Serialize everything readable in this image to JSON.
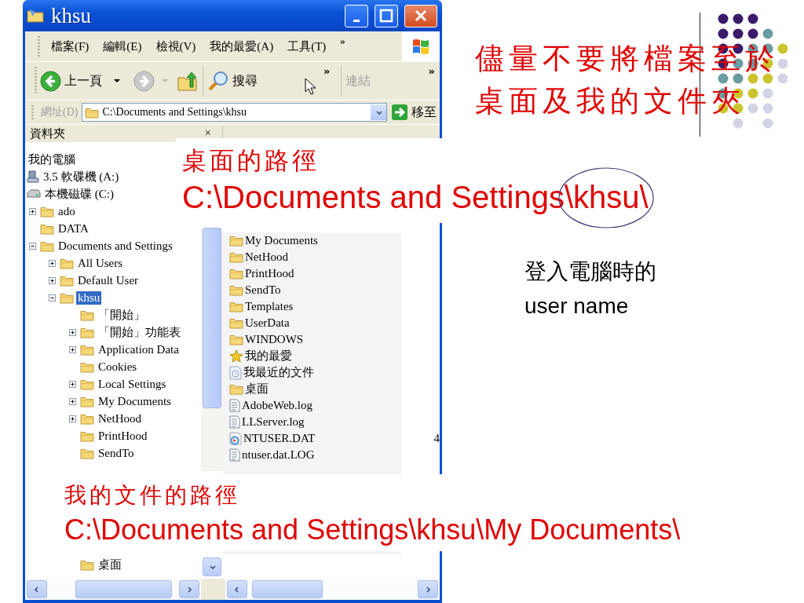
{
  "slide": {
    "title_lines": [
      "儘量不要將檔案至於",
      "桌面及我的文件夾"
    ]
  },
  "window": {
    "title": "khsu",
    "menu": [
      "檔案(F)",
      "編輯(E)",
      "檢視(V)",
      "我的最愛(A)",
      "工具(T)"
    ],
    "menu_overflow": "»",
    "toolbar": {
      "back": "上一頁",
      "search": "搜尋",
      "overflow": "»",
      "links": "連結",
      "links_overflow": "»"
    },
    "address": {
      "label": "網址(D)",
      "value": "C:\\Documents and Settings\\khsu",
      "go": "移至"
    },
    "folders_pane": {
      "title": "資料夾",
      "close": "×",
      "tree": [
        {
          "label": "我的電腦",
          "expandable": false,
          "selected": false,
          "children": [
            {
              "label": "3.5 軟碟機 (A:)",
              "kind": "floppy",
              "expandable": false,
              "selected": false
            },
            {
              "label": "本機磁碟 (C:)",
              "kind": "disk",
              "expandable": false,
              "selected": false,
              "children": [
                {
                  "label": "ado",
                  "kind": "folder",
                  "expandable": true,
                  "expanded": false,
                  "selected": false
                },
                {
                  "label": "DATA",
                  "kind": "folder",
                  "expandable": false,
                  "selected": false
                },
                {
                  "label": "Documents and Settings",
                  "kind": "folder",
                  "expandable": true,
                  "expanded": true,
                  "selected": false,
                  "children": [
                    {
                      "label": "All Users",
                      "kind": "folder",
                      "expandable": true,
                      "expanded": false,
                      "selected": false
                    },
                    {
                      "label": "Default User",
                      "kind": "folder",
                      "expandable": true,
                      "expanded": false,
                      "selected": false
                    },
                    {
                      "label": "khsu",
                      "kind": "folder",
                      "expandable": true,
                      "expanded": true,
                      "selected": true,
                      "children": [
                        {
                          "label": "「開始」",
                          "kind": "folder",
                          "expandable": false,
                          "selected": false
                        },
                        {
                          "label": "「開始」功能表",
                          "kind": "folder",
                          "expandable": true,
                          "expanded": false,
                          "selected": false
                        },
                        {
                          "label": "Application Data",
                          "kind": "folder",
                          "expandable": true,
                          "expanded": false,
                          "selected": false
                        },
                        {
                          "label": "Cookies",
                          "kind": "folder",
                          "expandable": false,
                          "selected": false
                        },
                        {
                          "label": "Local Settings",
                          "kind": "folder",
                          "expandable": true,
                          "expanded": false,
                          "selected": false
                        },
                        {
                          "label": "My Documents",
                          "kind": "folder",
                          "expandable": true,
                          "expanded": false,
                          "selected": false
                        },
                        {
                          "label": "NetHood",
                          "kind": "folder",
                          "expandable": true,
                          "expanded": false,
                          "selected": false
                        },
                        {
                          "label": "PrintHood",
                          "kind": "folder",
                          "expandable": false,
                          "selected": false
                        },
                        {
                          "label": "SendTo",
                          "kind": "folder",
                          "expandable": false,
                          "selected": false
                        }
                      ]
                    }
                  ]
                }
              ]
            }
          ]
        }
      ],
      "tree_tail": [
        {
          "label": "桌面",
          "kind": "folder",
          "expandable": false,
          "selected": false
        }
      ]
    },
    "file_list": [
      {
        "name": "My Documents",
        "kind": "folder"
      },
      {
        "name": "NetHood",
        "kind": "folder"
      },
      {
        "name": "PrintHood",
        "kind": "folder"
      },
      {
        "name": "SendTo",
        "kind": "folder"
      },
      {
        "name": "Templates",
        "kind": "folder"
      },
      {
        "name": "UserData",
        "kind": "folder"
      },
      {
        "name": "WINDOWS",
        "kind": "folder"
      },
      {
        "name": "我的最愛",
        "kind": "favorites"
      },
      {
        "name": "我最近的文件",
        "kind": "recent"
      },
      {
        "name": "桌面",
        "kind": "folder"
      },
      {
        "name": "AdobeWeb.log",
        "kind": "log"
      },
      {
        "name": "LLServer.log",
        "kind": "log"
      },
      {
        "name": "NTUSER.DAT",
        "kind": "system",
        "size": "4"
      },
      {
        "name": "ntuser.dat.LOG",
        "kind": "log"
      }
    ]
  },
  "callouts": [
    {
      "heading": "桌面的路徑",
      "path": "C:\\Documents and Settings\\khsu\\"
    },
    {
      "heading": "我的文件的路徑",
      "path": "C:\\Documents and Settings\\khsu\\My Documents\\"
    }
  ],
  "note": {
    "lines": [
      "登入電腦時的",
      "user name"
    ]
  }
}
